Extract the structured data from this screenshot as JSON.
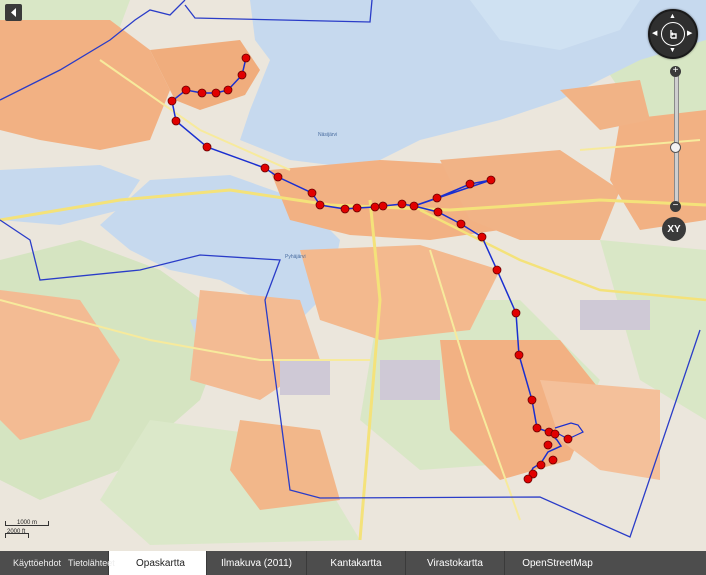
{
  "controls": {
    "zoom_in": "+",
    "zoom_out": "−",
    "xy_label": "XY"
  },
  "scale": {
    "upper": "1000 m",
    "lower": "2000 ft"
  },
  "map_labels": {
    "lake_north": "Näsijärvi",
    "lake_south": "Pyhäjärvi"
  },
  "bottom": {
    "links": [
      "Käyttöehdot",
      "Tietolähteet"
    ],
    "tabs": [
      {
        "label": "Opaskartta",
        "active": true
      },
      {
        "label": "Ilmakuva (2011)",
        "active": false
      },
      {
        "label": "Kantakartta",
        "active": false
      },
      {
        "label": "Virastokartta",
        "active": false
      },
      {
        "label": "OpenStreetMap",
        "active": false
      }
    ]
  },
  "colors": {
    "route": "#1a2fd0",
    "stop": "#e10000",
    "boundary": "#2a3cc8",
    "water": "#c6d9ee",
    "urban": "#f2b183",
    "green": "#d7e6c4"
  },
  "icons": [
    "back-arrow-icon",
    "location-pin-icon",
    "home-rotate-icon"
  ]
}
